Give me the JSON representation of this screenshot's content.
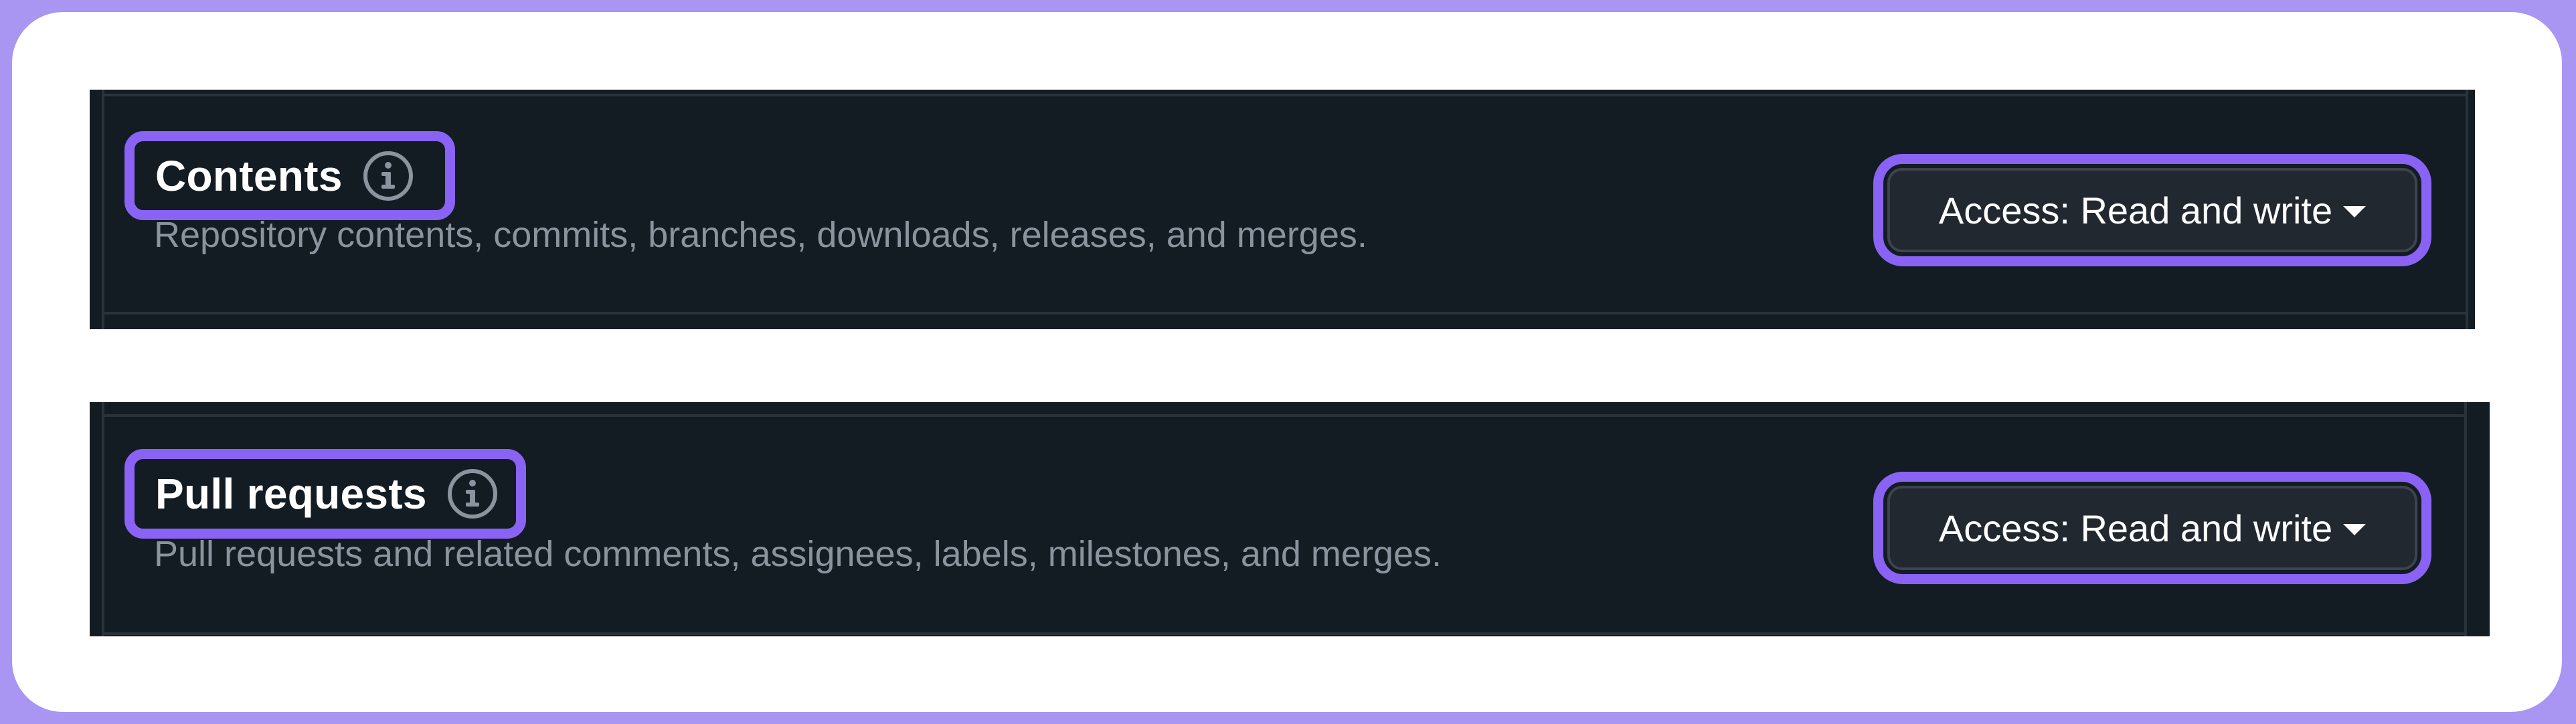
{
  "permissions": [
    {
      "title": "Contents",
      "description": "Repository contents, commits, branches, downloads, releases, and merges.",
      "access_label": "Access: Read and write",
      "info_icon": "info-icon"
    },
    {
      "title": "Pull requests",
      "description": "Pull requests and related comments, assignees, labels, milestones, and merges.",
      "access_label": "Access: Read and write",
      "info_icon": "info-icon"
    }
  ],
  "colors": {
    "background": "#a995f2",
    "card": "#ffffff",
    "panel": "#131c22",
    "highlight": "#8a63f5",
    "description_text": "#8a949e",
    "button": "#212830"
  }
}
